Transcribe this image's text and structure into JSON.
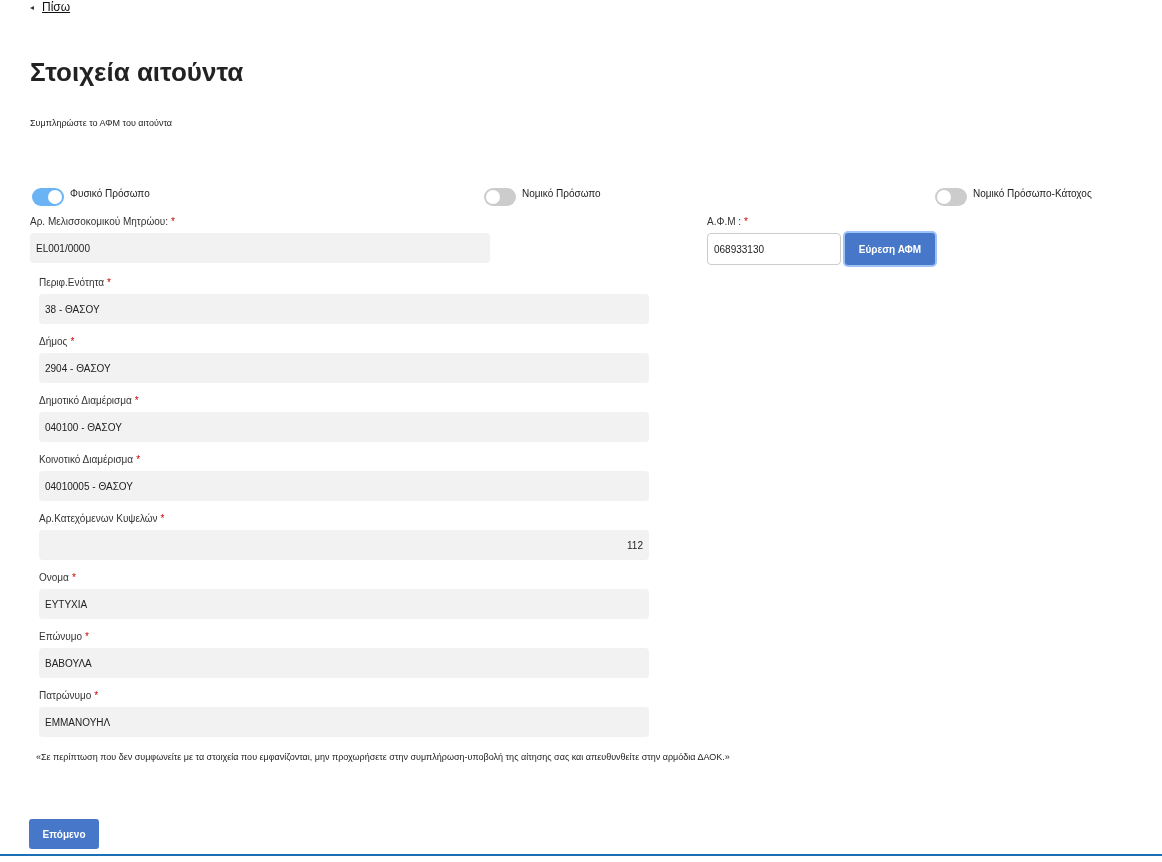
{
  "back_link": {
    "icon": "◂",
    "label": "Πίσω"
  },
  "title": "Στοιχεία αιτούντα",
  "subtitle": "Συμπληρώστε το ΑΦΜ του αιτούντα",
  "person_types": [
    {
      "label": "Φυσικό Πρόσωπο",
      "selected": true
    },
    {
      "label": "Νομικό Πρόσωπο",
      "selected": false
    },
    {
      "label": "Νομικό Πρόσωπο-Κάτοχος",
      "selected": false
    }
  ],
  "registry": {
    "label": "Αρ. Μελισσοκομικού Μητρώου:",
    "required_mark": "*",
    "value": "EL001/0000"
  },
  "tax_id": {
    "label": "Α.Φ.Μ :",
    "required_mark": "*",
    "value": "068933130",
    "button": "Εύρεση ΑΦΜ"
  },
  "fields": [
    {
      "label": "Περιφ.Ενότητα",
      "required_mark": "*",
      "value": "38 - ΘΑΣΟΥ",
      "kind": "text"
    },
    {
      "label": "Δήμος",
      "required_mark": "*",
      "value": "2904 - ΘΑΣΟΥ",
      "kind": "text"
    },
    {
      "label": "Δημοτικό Διαμέρισμα",
      "required_mark": "*",
      "value": "040100 - ΘΑΣΟΥ",
      "kind": "text"
    },
    {
      "label": "Κοινοτικό Διαμέρισμα",
      "required_mark": "*",
      "value": "04010005 - ΘΑΣΟΥ",
      "kind": "text"
    },
    {
      "label": "Αρ.Κατεχόμενων Κυψελών",
      "required_mark": "*",
      "value": "112",
      "kind": "number"
    },
    {
      "label": "Ονομα",
      "required_mark": "*",
      "value": "ΕΥΤΥΧΙΑ",
      "kind": "text"
    },
    {
      "label": "Επώνυμο",
      "required_mark": "*",
      "value": "ΒΑΒΟΥΛΑ",
      "kind": "text"
    },
    {
      "label": "Πατρώνυμο",
      "required_mark": "*",
      "value": "ΕΜΜΑΝΟΥΗΛ",
      "kind": "text"
    }
  ],
  "notice": "«Σε περίπτωση που δεν συμφωνείτε με τα στοιχεία που εμφανίζονται, μην προχωρήσετε στην συμπλήρωση-υποβολή της αίτησης σας και απευθυνθείτε στην αρμόδια ΔΑΟΚ.»",
  "next_button": "Επόμενο"
}
